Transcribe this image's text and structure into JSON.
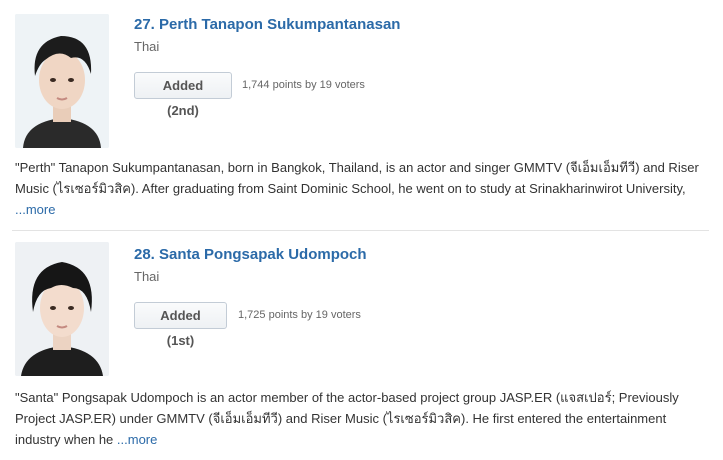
{
  "entries": [
    {
      "name": "27. Perth Tanapon Sukumpantanasan",
      "nationality": "Thai",
      "added_label": "Added (2nd)",
      "points_text": "1,744 points by 19 voters",
      "description": "\"Perth\" Tanapon Sukumpantanasan, born in Bangkok, Thailand, is an actor and singer GMMTV (จีเอ็มเอ็มทีวี) and Riser Music (ไรเซอร์มิวสิค). After graduating from Saint Dominic School, he went on to study at Srinakharinwirot University,",
      "more_label": "...more"
    },
    {
      "name": "28. Santa Pongsapak Udompoch",
      "nationality": "Thai",
      "added_label": "Added (1st)",
      "points_text": "1,725 points by 19 voters",
      "description": "\"Santa\" Pongsapak Udompoch is an actor member of the actor-based project group JASP.ER (แจสเปอร์; Previously Project JASP.ER) under GMMTV (จีเอ็มเอ็มทีวี) and Riser Music (ไรเซอร์มิวสิค). He first entered the entertainment industry when he",
      "more_label": "...more"
    }
  ],
  "colors": {
    "link": "#2b6aa8",
    "button_border": "#c3ccd6",
    "muted_text": "#666666",
    "divider": "#e3e3e3"
  }
}
